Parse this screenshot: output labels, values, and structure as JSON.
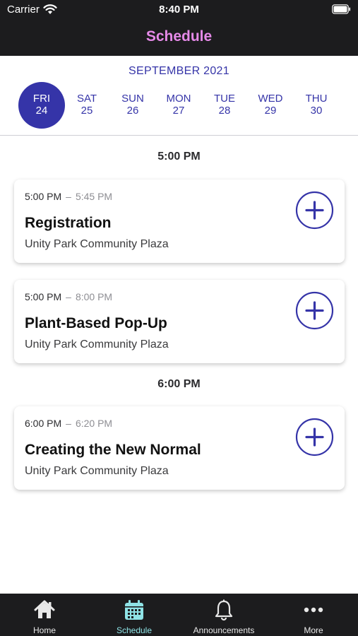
{
  "status_bar": {
    "carrier": "Carrier",
    "time": "8:40 PM"
  },
  "header": {
    "title": "Schedule"
  },
  "calendar": {
    "month": "SEPTEMBER 2021",
    "days": [
      {
        "name": "FRI",
        "date": "24",
        "selected": true
      },
      {
        "name": "SAT",
        "date": "25",
        "selected": false
      },
      {
        "name": "SUN",
        "date": "26",
        "selected": false
      },
      {
        "name": "MON",
        "date": "27",
        "selected": false
      },
      {
        "name": "TUE",
        "date": "28",
        "selected": false
      },
      {
        "name": "WED",
        "date": "29",
        "selected": false
      },
      {
        "name": "THU",
        "date": "30",
        "selected": false
      }
    ]
  },
  "schedule": {
    "groups": [
      {
        "time": "5:00 PM",
        "events": [
          {
            "start": "5:00 PM",
            "separator": "–",
            "end": "5:45 PM",
            "title": "Registration",
            "location": "Unity Park Community Plaza"
          },
          {
            "start": "5:00 PM",
            "separator": "–",
            "end": "8:00 PM",
            "title": "Plant-Based Pop-Up",
            "location": "Unity Park Community Plaza"
          }
        ]
      },
      {
        "time": "6:00 PM",
        "events": [
          {
            "start": "6:00 PM",
            "separator": "–",
            "end": "6:20 PM",
            "title": "Creating the New Normal",
            "location": "Unity Park Community Plaza"
          }
        ]
      }
    ]
  },
  "tabs": [
    {
      "label": "Home",
      "icon": "home-icon",
      "active": false
    },
    {
      "label": "Schedule",
      "icon": "calendar-icon",
      "active": true
    },
    {
      "label": "Announcements",
      "icon": "bell-icon",
      "active": false
    },
    {
      "label": "More",
      "icon": "more-icon",
      "active": false
    }
  ],
  "colors": {
    "accent": "#3534a8",
    "title_pink": "#e58ae8",
    "tab_active": "#8fe3e6",
    "tab_inactive": "#e8e8e8",
    "dark_bar": "#1c1c1e"
  }
}
